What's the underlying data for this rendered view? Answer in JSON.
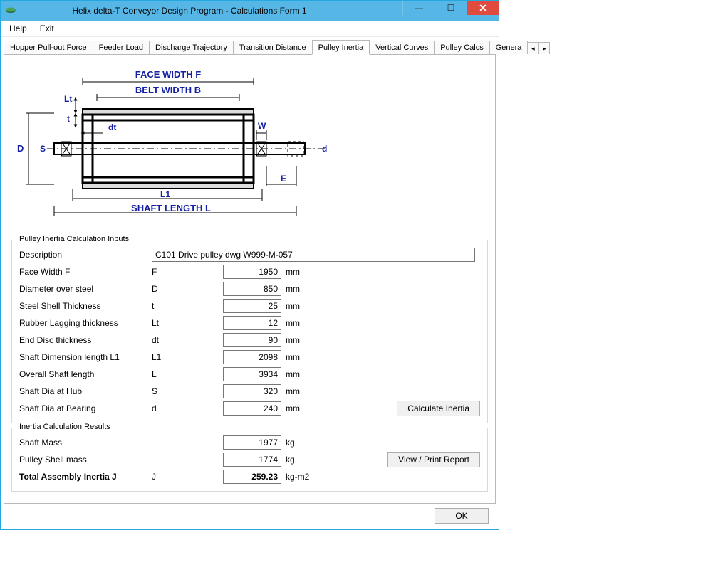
{
  "window": {
    "title": "Helix delta-T Conveyor Design Program - Calculations Form 1"
  },
  "menu": {
    "help": "Help",
    "exit": "Exit"
  },
  "tabs": [
    "Hopper Pull-out Force",
    "Feeder Load",
    "Discharge Trajectory",
    "Transition Distance",
    "Pulley Inertia",
    "Vertical Curves",
    "Pulley Calcs",
    "Genera"
  ],
  "diagram": {
    "face_width": "FACE WIDTH F",
    "belt_width": "BELT WIDTH B",
    "shaft_length": "SHAFT LENGTH L",
    "Lt": "Lt",
    "t": "t",
    "dt": "dt",
    "D": "D",
    "S": "S",
    "W": "W",
    "E": "E",
    "d": "d",
    "L1": "L1"
  },
  "inputs": {
    "legend": "Pulley Inertia Calculation Inputs",
    "description_label": "Description",
    "description_value": "C101 Drive pulley dwg W999-M-057",
    "rows": [
      {
        "label": "Face Width F",
        "sym": "F",
        "value": "1950",
        "unit": "mm"
      },
      {
        "label": "Diameter over steel",
        "sym": "D",
        "value": "850",
        "unit": "mm"
      },
      {
        "label": "Steel Shell Thickness",
        "sym": "t",
        "value": "25",
        "unit": "mm"
      },
      {
        "label": "Rubber Lagging thickness",
        "sym": "Lt",
        "value": "12",
        "unit": "mm"
      },
      {
        "label": "End Disc thickness",
        "sym": "dt",
        "value": "90",
        "unit": "mm"
      },
      {
        "label": "Shaft Dimension length L1",
        "sym": "L1",
        "value": "2098",
        "unit": "mm"
      },
      {
        "label": "Overall Shaft length",
        "sym": "L",
        "value": "3934",
        "unit": "mm"
      },
      {
        "label": "Shaft Dia at Hub",
        "sym": "S",
        "value": "320",
        "unit": "mm"
      },
      {
        "label": "Shaft Dia at Bearing",
        "sym": "d",
        "value": "240",
        "unit": "mm"
      }
    ],
    "calc_btn": "Calculate Inertia"
  },
  "results": {
    "legend": "Inertia Calculation Results",
    "rows": [
      {
        "label": "Shaft Mass",
        "sym": "",
        "value": "1977",
        "unit": "kg"
      },
      {
        "label": "Pulley Shell mass",
        "sym": "",
        "value": "1774",
        "unit": "kg"
      }
    ],
    "total_label": "Total Assembly Inertia J",
    "total_sym": "J",
    "total_value": "259.23",
    "total_unit": "kg-m2",
    "report_btn": "View / Print Report"
  },
  "footer": {
    "ok": "OK"
  }
}
